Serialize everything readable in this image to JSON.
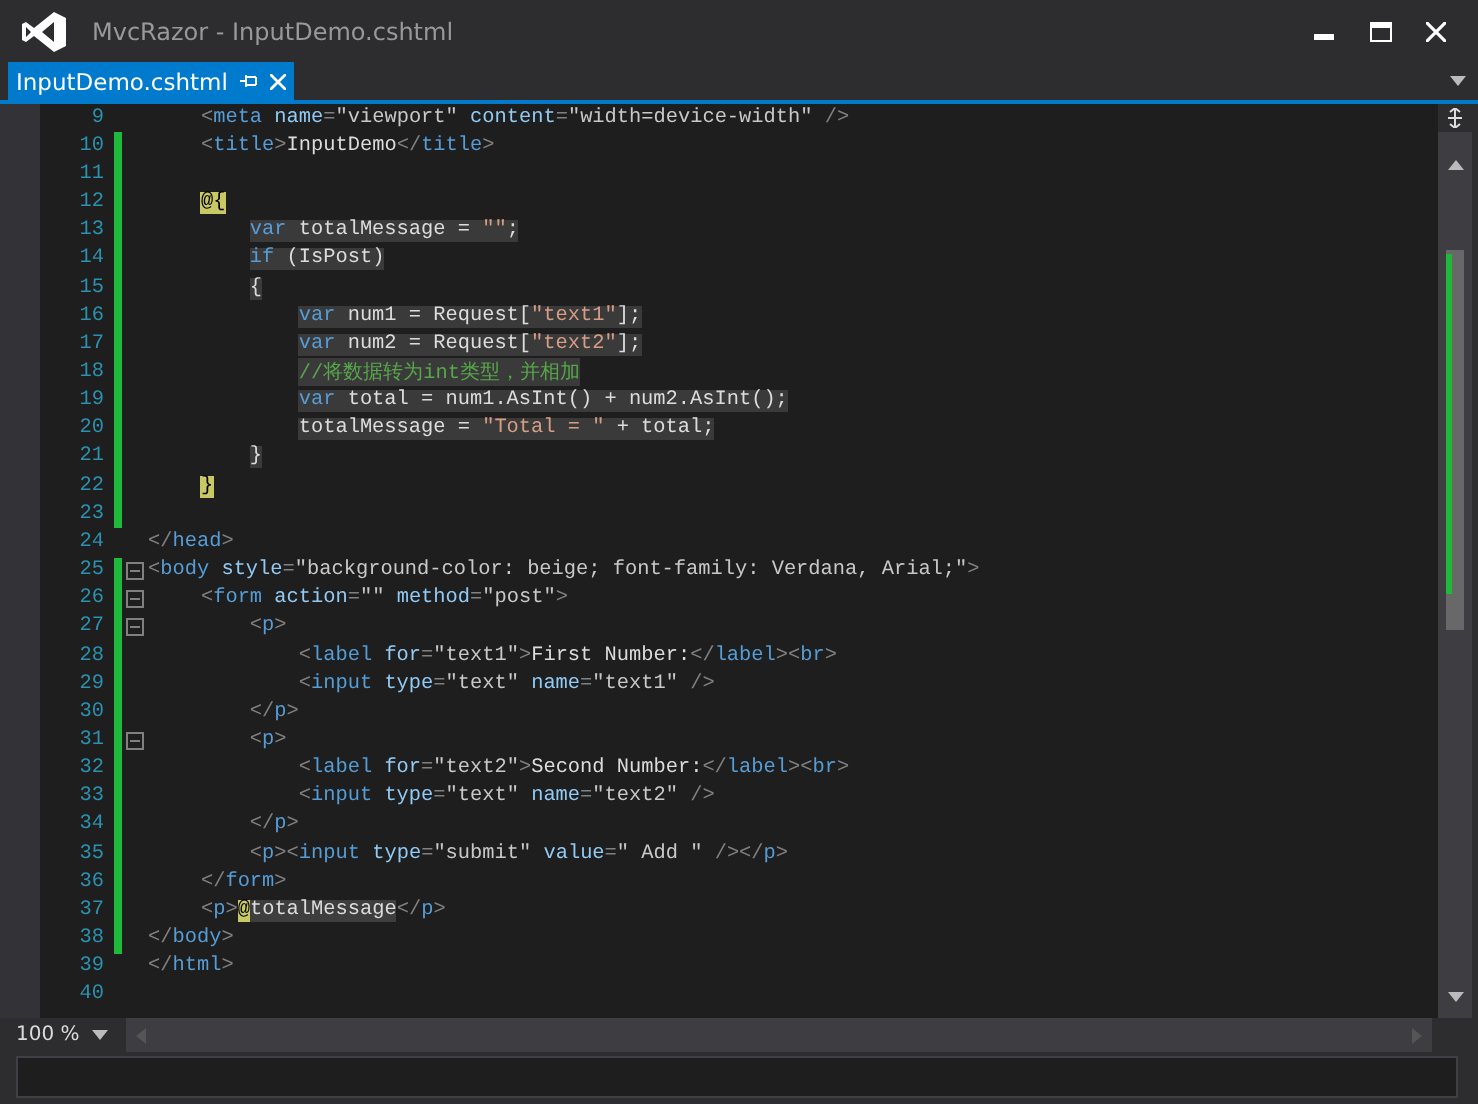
{
  "window": {
    "title": "MvcRazor - InputDemo.cshtml"
  },
  "tabs": [
    {
      "label": "InputDemo.cshtml",
      "selected": true
    }
  ],
  "editor": {
    "lines": [
      {
        "number": "9",
        "changed": false,
        "collapsible": false,
        "shaded": false,
        "tokens": [
          {
            "kind": "p",
            "t": "    <"
          },
          {
            "kind": "tag",
            "t": "meta"
          },
          {
            "kind": "attr",
            "t": " name"
          },
          {
            "kind": "p",
            "t": "="
          },
          {
            "kind": "val",
            "t": "\"viewport\""
          },
          {
            "kind": "attr",
            "t": " content"
          },
          {
            "kind": "p",
            "t": "="
          },
          {
            "kind": "val",
            "t": "\"width=device-width\""
          },
          {
            "kind": "p",
            "t": " />"
          }
        ]
      },
      {
        "number": "10",
        "changed": true,
        "collapsible": false,
        "shaded": false,
        "tokens": [
          {
            "kind": "p",
            "t": "    <"
          },
          {
            "kind": "tag",
            "t": "title"
          },
          {
            "kind": "p",
            "t": ">"
          },
          {
            "kind": "txt",
            "t": "InputDemo"
          },
          {
            "kind": "p",
            "t": "</"
          },
          {
            "kind": "tag",
            "t": "title"
          },
          {
            "kind": "p",
            "t": ">"
          }
        ]
      },
      {
        "number": "11",
        "changed": true,
        "collapsible": false
      },
      {
        "number": "12",
        "changed": true,
        "collapsible": false,
        "shaded": false,
        "tokens": [
          {
            "kind": "razor",
            "t": "    @{"
          }
        ]
      },
      {
        "number": "13",
        "changed": true,
        "collapsible": false,
        "shaded": true,
        "tokens": [
          {
            "kind": "kw",
            "t": "        var"
          },
          {
            "kind": "txt",
            "t": " totalMessage = "
          },
          {
            "kind": "str",
            "t": "\"\""
          },
          {
            "kind": "txt",
            "t": ";"
          }
        ]
      },
      {
        "number": "14",
        "changed": true,
        "collapsible": false,
        "shaded": true,
        "tokens": [
          {
            "kind": "kw",
            "t": "        if"
          },
          {
            "kind": "txt",
            "t": " (IsPost)"
          }
        ]
      },
      {
        "number": "15",
        "changed": true,
        "collapsible": false,
        "shaded": true,
        "tokens": [
          {
            "kind": "txt",
            "t": "        {"
          }
        ]
      },
      {
        "number": "16",
        "changed": true,
        "collapsible": false,
        "shaded": true,
        "tokens": [
          {
            "kind": "kw",
            "t": "            var"
          },
          {
            "kind": "txt",
            "t": " num1 = Request["
          },
          {
            "kind": "str",
            "t": "\"text1\""
          },
          {
            "kind": "txt",
            "t": "];"
          }
        ]
      },
      {
        "number": "17",
        "changed": true,
        "collapsible": false,
        "shaded": true,
        "tokens": [
          {
            "kind": "kw",
            "t": "            var"
          },
          {
            "kind": "txt",
            "t": " num2 = Request["
          },
          {
            "kind": "str",
            "t": "\"text2\""
          },
          {
            "kind": "txt",
            "t": "];"
          }
        ]
      },
      {
        "number": "18",
        "changed": true,
        "collapsible": false,
        "shaded": true,
        "tokens": [
          {
            "kind": "cmt",
            "t": "            //将数据转为int类型，并相加"
          }
        ]
      },
      {
        "number": "19",
        "changed": true,
        "collapsible": false,
        "shaded": true,
        "tokens": [
          {
            "kind": "kw",
            "t": "            var"
          },
          {
            "kind": "txt",
            "t": " total = num1.AsInt() + num2.AsInt();"
          }
        ]
      },
      {
        "number": "20",
        "changed": true,
        "collapsible": false,
        "shaded": true,
        "tokens": [
          {
            "kind": "txt",
            "t": "            totalMessage = "
          },
          {
            "kind": "str",
            "t": "\"Total = \""
          },
          {
            "kind": "txt",
            "t": " + total;"
          }
        ]
      },
      {
        "number": "21",
        "changed": true,
        "collapsible": false,
        "shaded": true,
        "tokens": [
          {
            "kind": "txt",
            "t": "        }"
          }
        ]
      },
      {
        "number": "22",
        "changed": true,
        "collapsible": false,
        "shaded": false,
        "tokens": [
          {
            "kind": "razor",
            "t": "    }"
          }
        ]
      },
      {
        "number": "23",
        "changed": true,
        "collapsible": false
      },
      {
        "number": "24",
        "changed": false,
        "collapsible": false,
        "shaded": false,
        "tokens": [
          {
            "kind": "p",
            "t": "</"
          },
          {
            "kind": "tag",
            "t": "head"
          },
          {
            "kind": "p",
            "t": ">"
          }
        ]
      },
      {
        "number": "25",
        "changed": true,
        "collapsible": true,
        "shaded": false,
        "tokens": [
          {
            "kind": "p",
            "t": "<"
          },
          {
            "kind": "tag",
            "t": "body"
          },
          {
            "kind": "attr",
            "t": " style"
          },
          {
            "kind": "p",
            "t": "="
          },
          {
            "kind": "val",
            "t": "\"background-color: beige; font-family: Verdana, Arial;\""
          },
          {
            "kind": "p",
            "t": ">"
          }
        ]
      },
      {
        "number": "26",
        "changed": true,
        "collapsible": true,
        "shaded": false,
        "tokens": [
          {
            "kind": "p",
            "t": "    <"
          },
          {
            "kind": "tag",
            "t": "form"
          },
          {
            "kind": "attr",
            "t": " action"
          },
          {
            "kind": "p",
            "t": "="
          },
          {
            "kind": "val",
            "t": "\"\""
          },
          {
            "kind": "attr",
            "t": " method"
          },
          {
            "kind": "p",
            "t": "="
          },
          {
            "kind": "val",
            "t": "\"post\""
          },
          {
            "kind": "p",
            "t": ">"
          }
        ]
      },
      {
        "number": "27",
        "changed": true,
        "collapsible": true,
        "shaded": false,
        "tokens": [
          {
            "kind": "p",
            "t": "        <"
          },
          {
            "kind": "tag",
            "t": "p"
          },
          {
            "kind": "p",
            "t": ">"
          }
        ]
      },
      {
        "number": "28",
        "changed": true,
        "collapsible": false,
        "shaded": false,
        "tokens": [
          {
            "kind": "p",
            "t": "            <"
          },
          {
            "kind": "tag",
            "t": "label"
          },
          {
            "kind": "attr",
            "t": " for"
          },
          {
            "kind": "p",
            "t": "="
          },
          {
            "kind": "val",
            "t": "\"text1\""
          },
          {
            "kind": "p",
            "t": ">"
          },
          {
            "kind": "txt",
            "t": "First Number:"
          },
          {
            "kind": "p",
            "t": "</"
          },
          {
            "kind": "tag",
            "t": "label"
          },
          {
            "kind": "p",
            "t": "><"
          },
          {
            "kind": "tag",
            "t": "br"
          },
          {
            "kind": "p",
            "t": ">"
          }
        ]
      },
      {
        "number": "29",
        "changed": true,
        "collapsible": false,
        "shaded": false,
        "tokens": [
          {
            "kind": "p",
            "t": "            <"
          },
          {
            "kind": "tag",
            "t": "input"
          },
          {
            "kind": "attr",
            "t": " type"
          },
          {
            "kind": "p",
            "t": "="
          },
          {
            "kind": "val",
            "t": "\"text\""
          },
          {
            "kind": "attr",
            "t": " name"
          },
          {
            "kind": "p",
            "t": "="
          },
          {
            "kind": "val",
            "t": "\"text1\""
          },
          {
            "kind": "p",
            "t": " />"
          }
        ]
      },
      {
        "number": "30",
        "changed": true,
        "collapsible": false,
        "shaded": false,
        "tokens": [
          {
            "kind": "p",
            "t": "        </"
          },
          {
            "kind": "tag",
            "t": "p"
          },
          {
            "kind": "p",
            "t": ">"
          }
        ]
      },
      {
        "number": "31",
        "changed": true,
        "collapsible": true,
        "shaded": false,
        "tokens": [
          {
            "kind": "p",
            "t": "        <"
          },
          {
            "kind": "tag",
            "t": "p"
          },
          {
            "kind": "p",
            "t": ">"
          }
        ]
      },
      {
        "number": "32",
        "changed": true,
        "collapsible": false,
        "shaded": false,
        "tokens": [
          {
            "kind": "p",
            "t": "            <"
          },
          {
            "kind": "tag",
            "t": "label"
          },
          {
            "kind": "attr",
            "t": " for"
          },
          {
            "kind": "p",
            "t": "="
          },
          {
            "kind": "val",
            "t": "\"text2\""
          },
          {
            "kind": "p",
            "t": ">"
          },
          {
            "kind": "txt",
            "t": "Second Number:"
          },
          {
            "kind": "p",
            "t": "</"
          },
          {
            "kind": "tag",
            "t": "label"
          },
          {
            "kind": "p",
            "t": "><"
          },
          {
            "kind": "tag",
            "t": "br"
          },
          {
            "kind": "p",
            "t": ">"
          }
        ]
      },
      {
        "number": "33",
        "changed": true,
        "collapsible": false,
        "shaded": false,
        "tokens": [
          {
            "kind": "p",
            "t": "            <"
          },
          {
            "kind": "tag",
            "t": "input"
          },
          {
            "kind": "attr",
            "t": " type"
          },
          {
            "kind": "p",
            "t": "="
          },
          {
            "kind": "val",
            "t": "\"text\""
          },
          {
            "kind": "attr",
            "t": " name"
          },
          {
            "kind": "p",
            "t": "="
          },
          {
            "kind": "val",
            "t": "\"text2\""
          },
          {
            "kind": "p",
            "t": " />"
          }
        ]
      },
      {
        "number": "34",
        "changed": true,
        "collapsible": false,
        "shaded": false,
        "tokens": [
          {
            "kind": "p",
            "t": "        </"
          },
          {
            "kind": "tag",
            "t": "p"
          },
          {
            "kind": "p",
            "t": ">"
          }
        ]
      },
      {
        "number": "35",
        "changed": true,
        "collapsible": false,
        "shaded": false,
        "tokens": [
          {
            "kind": "p",
            "t": "        <"
          },
          {
            "kind": "tag",
            "t": "p"
          },
          {
            "kind": "p",
            "t": "><"
          },
          {
            "kind": "tag",
            "t": "input"
          },
          {
            "kind": "attr",
            "t": " type"
          },
          {
            "kind": "p",
            "t": "="
          },
          {
            "kind": "val",
            "t": "\"submit\""
          },
          {
            "kind": "attr",
            "t": " value"
          },
          {
            "kind": "p",
            "t": "="
          },
          {
            "kind": "val",
            "t": "\" Add \""
          },
          {
            "kind": "p",
            "t": " /></"
          },
          {
            "kind": "tag",
            "t": "p"
          },
          {
            "kind": "p",
            "t": ">"
          }
        ]
      },
      {
        "number": "36",
        "changed": true,
        "collapsible": false,
        "shaded": false,
        "tokens": [
          {
            "kind": "p",
            "t": "    </"
          },
          {
            "kind": "tag",
            "t": "form"
          },
          {
            "kind": "p",
            "t": ">"
          }
        ]
      },
      {
        "number": "37",
        "changed": true,
        "collapsible": false,
        "shaded": false,
        "tokens": [
          {
            "kind": "p",
            "t": "    <"
          },
          {
            "kind": "tag",
            "t": "p"
          },
          {
            "kind": "p",
            "t": ">"
          },
          {
            "kind": "razor",
            "t": "@"
          },
          {
            "kind": "expr",
            "t": "totalMessage"
          },
          {
            "kind": "p",
            "t": "</"
          },
          {
            "kind": "tag",
            "t": "p"
          },
          {
            "kind": "p",
            "t": ">"
          }
        ]
      },
      {
        "number": "38",
        "changed": true,
        "collapsible": false,
        "shaded": false,
        "tokens": [
          {
            "kind": "p",
            "t": "</"
          },
          {
            "kind": "tag",
            "t": "body"
          },
          {
            "kind": "p",
            "t": ">"
          }
        ]
      },
      {
        "number": "39",
        "changed": false,
        "collapsible": false,
        "shaded": false,
        "tokens": [
          {
            "kind": "p",
            "t": "</"
          },
          {
            "kind": "tag",
            "t": "html"
          },
          {
            "kind": "p",
            "t": ">"
          }
        ]
      },
      {
        "number": "40",
        "changed": false,
        "collapsible": false
      }
    ]
  },
  "zoom": {
    "value": "100 %"
  }
}
